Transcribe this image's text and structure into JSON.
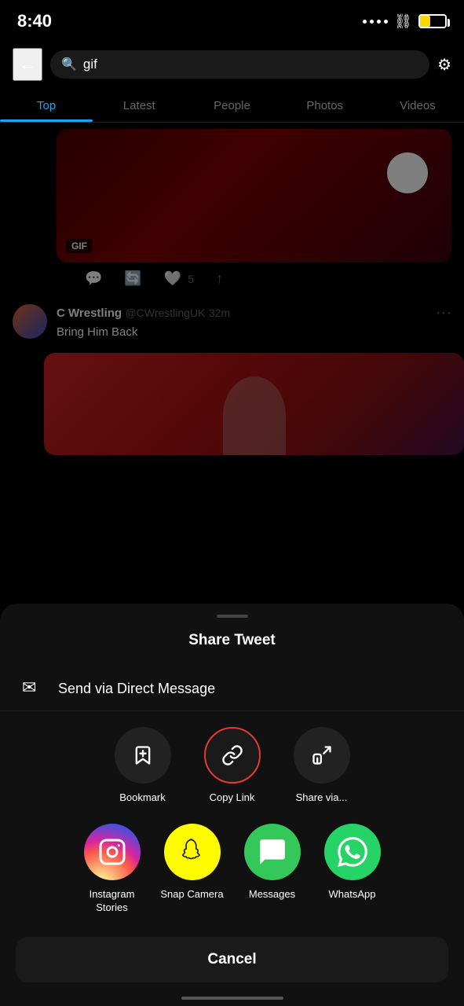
{
  "statusBar": {
    "time": "8:40"
  },
  "searchBar": {
    "backLabel": "←",
    "searchQuery": "gif",
    "filterLabel": "⚙"
  },
  "tabs": {
    "items": [
      {
        "label": "Top",
        "active": true
      },
      {
        "label": "Latest",
        "active": false
      },
      {
        "label": "People",
        "active": false
      },
      {
        "label": "Photos",
        "active": false
      },
      {
        "label": "Videos",
        "active": false
      }
    ]
  },
  "tweet1": {
    "gifBadge": "GIF"
  },
  "tweet2": {
    "author": "C Wrestling",
    "handle": "@CWrestlingUK",
    "timeAgo": "32m",
    "text": "Bring Him Back"
  },
  "sheet": {
    "title": "Share Tweet",
    "dmLabel": "Send via Direct Message",
    "actions": [
      {
        "id": "bookmark",
        "label": "Bookmark",
        "icon": "🔖",
        "highlighted": false
      },
      {
        "id": "copy-link",
        "label": "Copy Link",
        "icon": "🔗",
        "highlighted": true
      },
      {
        "id": "share-via",
        "label": "Share via...",
        "icon": "↑",
        "highlighted": false
      }
    ],
    "apps": [
      {
        "id": "instagram",
        "label": "Instagram Stories",
        "type": "instagram"
      },
      {
        "id": "snapchat",
        "label": "Snap Camera",
        "type": "snapchat"
      },
      {
        "id": "messages",
        "label": "Messages",
        "type": "messages"
      },
      {
        "id": "whatsapp",
        "label": "WhatsApp",
        "type": "whatsapp"
      }
    ],
    "cancelLabel": "Cancel"
  }
}
